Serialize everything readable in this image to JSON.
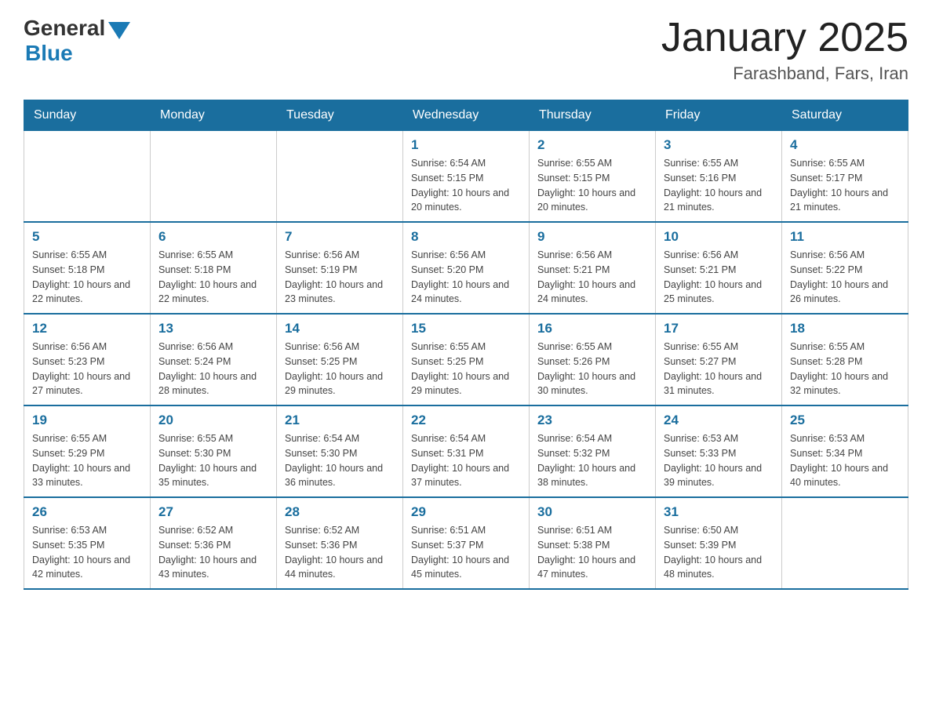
{
  "header": {
    "logo_general": "General",
    "logo_blue": "Blue",
    "month_title": "January 2025",
    "location": "Farashband, Fars, Iran"
  },
  "days_of_week": [
    "Sunday",
    "Monday",
    "Tuesday",
    "Wednesday",
    "Thursday",
    "Friday",
    "Saturday"
  ],
  "weeks": [
    [
      null,
      null,
      null,
      {
        "num": "1",
        "sunrise": "6:54 AM",
        "sunset": "5:15 PM",
        "daylight": "10 hours and 20 minutes."
      },
      {
        "num": "2",
        "sunrise": "6:55 AM",
        "sunset": "5:15 PM",
        "daylight": "10 hours and 20 minutes."
      },
      {
        "num": "3",
        "sunrise": "6:55 AM",
        "sunset": "5:16 PM",
        "daylight": "10 hours and 21 minutes."
      },
      {
        "num": "4",
        "sunrise": "6:55 AM",
        "sunset": "5:17 PM",
        "daylight": "10 hours and 21 minutes."
      }
    ],
    [
      {
        "num": "5",
        "sunrise": "6:55 AM",
        "sunset": "5:18 PM",
        "daylight": "10 hours and 22 minutes."
      },
      {
        "num": "6",
        "sunrise": "6:55 AM",
        "sunset": "5:18 PM",
        "daylight": "10 hours and 22 minutes."
      },
      {
        "num": "7",
        "sunrise": "6:56 AM",
        "sunset": "5:19 PM",
        "daylight": "10 hours and 23 minutes."
      },
      {
        "num": "8",
        "sunrise": "6:56 AM",
        "sunset": "5:20 PM",
        "daylight": "10 hours and 24 minutes."
      },
      {
        "num": "9",
        "sunrise": "6:56 AM",
        "sunset": "5:21 PM",
        "daylight": "10 hours and 24 minutes."
      },
      {
        "num": "10",
        "sunrise": "6:56 AM",
        "sunset": "5:21 PM",
        "daylight": "10 hours and 25 minutes."
      },
      {
        "num": "11",
        "sunrise": "6:56 AM",
        "sunset": "5:22 PM",
        "daylight": "10 hours and 26 minutes."
      }
    ],
    [
      {
        "num": "12",
        "sunrise": "6:56 AM",
        "sunset": "5:23 PM",
        "daylight": "10 hours and 27 minutes."
      },
      {
        "num": "13",
        "sunrise": "6:56 AM",
        "sunset": "5:24 PM",
        "daylight": "10 hours and 28 minutes."
      },
      {
        "num": "14",
        "sunrise": "6:56 AM",
        "sunset": "5:25 PM",
        "daylight": "10 hours and 29 minutes."
      },
      {
        "num": "15",
        "sunrise": "6:55 AM",
        "sunset": "5:25 PM",
        "daylight": "10 hours and 29 minutes."
      },
      {
        "num": "16",
        "sunrise": "6:55 AM",
        "sunset": "5:26 PM",
        "daylight": "10 hours and 30 minutes."
      },
      {
        "num": "17",
        "sunrise": "6:55 AM",
        "sunset": "5:27 PM",
        "daylight": "10 hours and 31 minutes."
      },
      {
        "num": "18",
        "sunrise": "6:55 AM",
        "sunset": "5:28 PM",
        "daylight": "10 hours and 32 minutes."
      }
    ],
    [
      {
        "num": "19",
        "sunrise": "6:55 AM",
        "sunset": "5:29 PM",
        "daylight": "10 hours and 33 minutes."
      },
      {
        "num": "20",
        "sunrise": "6:55 AM",
        "sunset": "5:30 PM",
        "daylight": "10 hours and 35 minutes."
      },
      {
        "num": "21",
        "sunrise": "6:54 AM",
        "sunset": "5:30 PM",
        "daylight": "10 hours and 36 minutes."
      },
      {
        "num": "22",
        "sunrise": "6:54 AM",
        "sunset": "5:31 PM",
        "daylight": "10 hours and 37 minutes."
      },
      {
        "num": "23",
        "sunrise": "6:54 AM",
        "sunset": "5:32 PM",
        "daylight": "10 hours and 38 minutes."
      },
      {
        "num": "24",
        "sunrise": "6:53 AM",
        "sunset": "5:33 PM",
        "daylight": "10 hours and 39 minutes."
      },
      {
        "num": "25",
        "sunrise": "6:53 AM",
        "sunset": "5:34 PM",
        "daylight": "10 hours and 40 minutes."
      }
    ],
    [
      {
        "num": "26",
        "sunrise": "6:53 AM",
        "sunset": "5:35 PM",
        "daylight": "10 hours and 42 minutes."
      },
      {
        "num": "27",
        "sunrise": "6:52 AM",
        "sunset": "5:36 PM",
        "daylight": "10 hours and 43 minutes."
      },
      {
        "num": "28",
        "sunrise": "6:52 AM",
        "sunset": "5:36 PM",
        "daylight": "10 hours and 44 minutes."
      },
      {
        "num": "29",
        "sunrise": "6:51 AM",
        "sunset": "5:37 PM",
        "daylight": "10 hours and 45 minutes."
      },
      {
        "num": "30",
        "sunrise": "6:51 AM",
        "sunset": "5:38 PM",
        "daylight": "10 hours and 47 minutes."
      },
      {
        "num": "31",
        "sunrise": "6:50 AM",
        "sunset": "5:39 PM",
        "daylight": "10 hours and 48 minutes."
      },
      null
    ]
  ]
}
